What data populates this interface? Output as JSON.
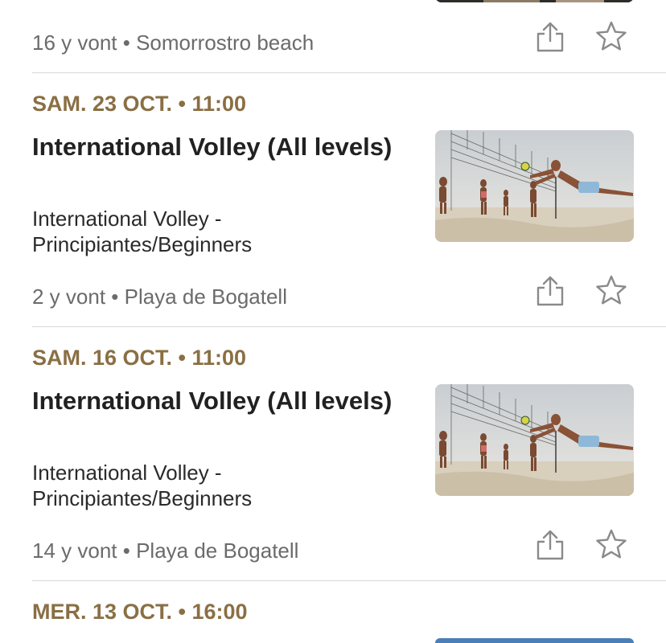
{
  "events": [
    {
      "attendees": "16 y vont",
      "location": "Somorrostro beach"
    },
    {
      "date": "SAM. 23 OCT. • 11:00",
      "title": "International Volley (All levels)",
      "description": "International Volley - Principiantes/Beginners",
      "attendees": "2 y vont",
      "location": "Playa de Bogatell"
    },
    {
      "date": "SAM. 16 OCT. • 11:00",
      "title": "International Volley (All levels)",
      "description": "International Volley - Principiantes/Beginners",
      "attendees": "14 y vont",
      "location": "Playa de Bogatell"
    },
    {
      "date": "MER. 13 OCT. • 16:00"
    }
  ],
  "separator": " • ",
  "icons": {
    "share": "share-icon",
    "favorite": "star-icon"
  },
  "colors": {
    "date_accent": "#8a6f44",
    "text": "#212121",
    "meta": "#6b6b6b",
    "icon": "#8a8a8a",
    "divider": "#d8d8d8"
  }
}
